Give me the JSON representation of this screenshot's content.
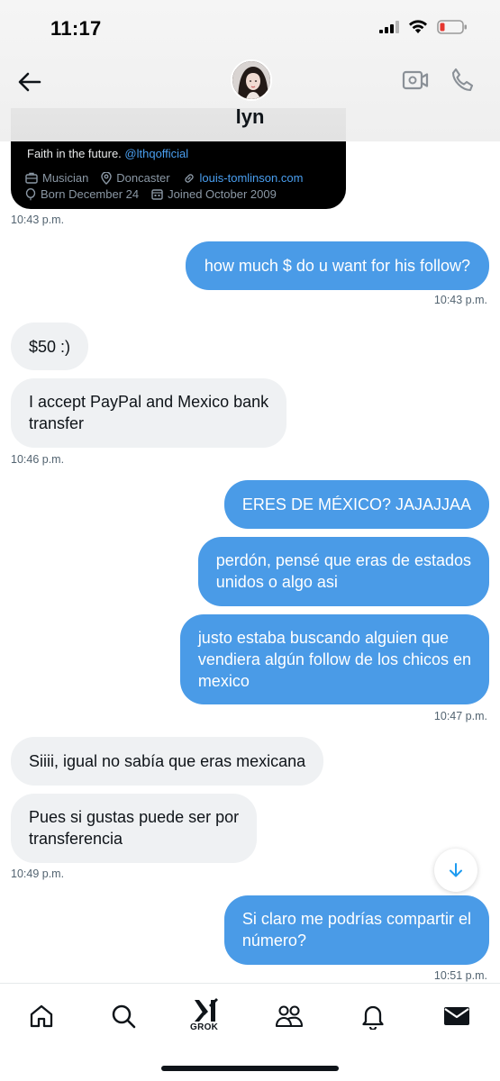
{
  "status_bar": {
    "time": "11:17"
  },
  "header": {
    "contact_name": "lyn"
  },
  "profile_card": {
    "bio_text": "Faith in the future.",
    "bio_mention": "@lthqofficial",
    "job": "Musician",
    "location": "Doncaster",
    "website": "louis-tomlinson.com",
    "born": "Born December 24",
    "joined": "Joined October 2009"
  },
  "messages": [
    {
      "id": "m0ts",
      "timestamp": "10:43 p.m."
    },
    {
      "id": "m1",
      "side": "out",
      "lines": [
        "how much $ do u want for his follow?"
      ],
      "timestamp": "10:43 p.m."
    },
    {
      "id": "m2",
      "side": "in",
      "lines": [
        "$50 :)"
      ]
    },
    {
      "id": "m3",
      "side": "in",
      "lines": [
        "I accept PayPal and Mexico bank",
        "transfer"
      ],
      "timestamp": "10:46 p.m."
    },
    {
      "id": "m4",
      "side": "out",
      "lines": [
        "ERES DE MÉXICO? JAJAJJAA"
      ]
    },
    {
      "id": "m5",
      "side": "out",
      "lines": [
        "perdón, pensé que eras de estados",
        "unidos o algo asi"
      ]
    },
    {
      "id": "m6",
      "side": "out",
      "lines": [
        "justo estaba buscando alguien que",
        "vendiera algún follow de los chicos en",
        "mexico"
      ],
      "timestamp": "10:47 p.m."
    },
    {
      "id": "m7",
      "side": "in",
      "lines": [
        "Siiii, igual no sabía que eras mexicana"
      ]
    },
    {
      "id": "m8",
      "side": "in",
      "lines": [
        "Pues si gustas puede ser por",
        "transferencia"
      ],
      "timestamp": "10:49 p.m."
    },
    {
      "id": "m9",
      "side": "out",
      "lines": [
        "Si claro me podrías compartir el",
        "número?"
      ],
      "timestamp": "10:51 p.m."
    }
  ],
  "bottom_nav": {
    "items": [
      "home-icon",
      "search-icon",
      "grok-icon",
      "communities-icon",
      "notifications-icon",
      "messages-icon"
    ],
    "grok_label": "GROK"
  },
  "colors": {
    "outgoing_bubble": "#4a9be7",
    "incoming_bubble": "#eff1f3",
    "link": "#4a9ff0",
    "battery_low": "#e5362f"
  }
}
